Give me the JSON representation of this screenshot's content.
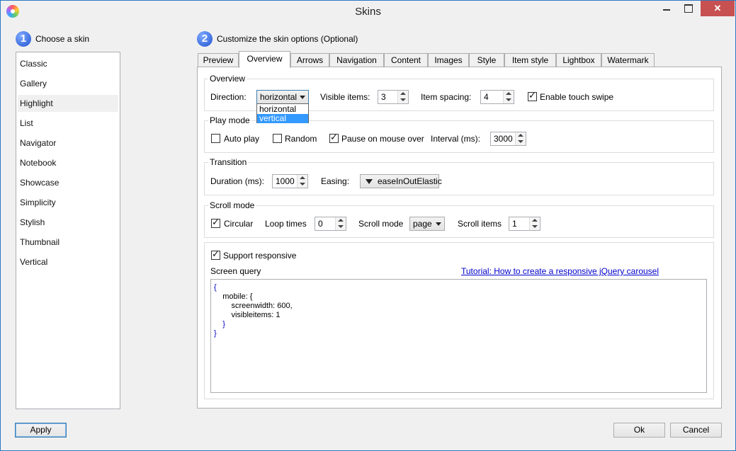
{
  "window": {
    "title": "Skins",
    "close_glyph": "✕"
  },
  "step1": {
    "number": "1",
    "label": "Choose a skin"
  },
  "step2": {
    "number": "2",
    "label": "Customize the skin options (Optional)"
  },
  "skins": {
    "items": [
      "Classic",
      "Gallery",
      "Highlight",
      "List",
      "Navigator",
      "Notebook",
      "Showcase",
      "Simplicity",
      "Stylish",
      "Thumbnail",
      "Vertical"
    ],
    "selected": "Highlight"
  },
  "tabs": {
    "items": [
      "Preview",
      "Overview",
      "Arrows",
      "Navigation",
      "Content",
      "Images",
      "Style",
      "Item style",
      "Lightbox",
      "Watermark"
    ],
    "active": "Overview"
  },
  "overview": {
    "group_label": "Overview",
    "direction_label": "Direction:",
    "direction_value": "horizontal",
    "direction_options": [
      "horizontal",
      "vertical"
    ],
    "direction_highlighted": "vertical",
    "visible_items_label": "Visible items:",
    "visible_items_value": "3",
    "item_spacing_label": "Item spacing:",
    "item_spacing_value": "4",
    "touch_swipe_label": "Enable touch swipe",
    "touch_swipe_checked": true
  },
  "playmode": {
    "group_label": "Play mode",
    "autoplay_label": "Auto play",
    "autoplay_checked": false,
    "random_label": "Random",
    "random_checked": false,
    "pause_label": "Pause on mouse over",
    "pause_checked": true,
    "interval_label": "Interval (ms):",
    "interval_value": "3000"
  },
  "transition": {
    "group_label": "Transition",
    "duration_label": "Duration (ms):",
    "duration_value": "1000",
    "easing_label": "Easing:",
    "easing_value": "easeInOutElastic"
  },
  "scrollmode": {
    "group_label": "Scroll mode",
    "circular_label": "Circular",
    "circular_checked": true,
    "loop_label": "Loop times",
    "loop_value": "0",
    "mode_label": "Scroll mode",
    "mode_value": "page",
    "items_label": "Scroll items",
    "items_value": "1"
  },
  "responsive": {
    "support_label": "Support responsive",
    "support_checked": true,
    "screen_query_label": "Screen query",
    "tutorial_link": "Tutorial: How to create a responsive jQuery carousel",
    "code_lines": [
      "{",
      "    mobile: {",
      "        screenwidth: 600,",
      "        visibleitems: 1",
      "    }",
      "}"
    ]
  },
  "buttons": {
    "apply": "Apply",
    "ok": "Ok",
    "cancel": "Cancel"
  }
}
